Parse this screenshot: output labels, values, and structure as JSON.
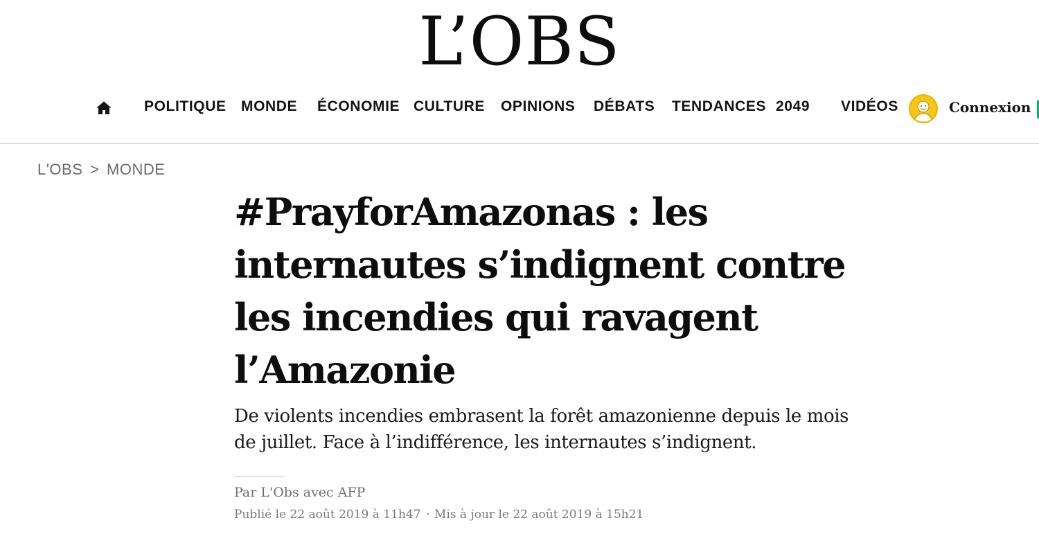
{
  "header": {
    "logo": "L’OBS"
  },
  "nav": {
    "home_icon": "home-icon",
    "items": [
      "POLITIQUE",
      "MONDE",
      "ÉCONOMIE",
      "CULTURE",
      "OPINIONS",
      "DÉBATS",
      "TENDANCES",
      "2049",
      "VIDÉOS"
    ],
    "avatar_icon": "user-avatar-icon",
    "login_label": "Connexion"
  },
  "breadcrumb": {
    "root": "L'OBS",
    "separator": ">",
    "section": "MONDE"
  },
  "article": {
    "headline": "#PrayforAmazonas : les internautes s’indignent contre les incendies qui ravagent l’Amazonie",
    "lede": "De violents incendies embrasent la forêt amazonienne depuis le mois de juillet. Face à l’indifférence, les internautes s’indignent.",
    "byline": "Par L'Obs avec AFP",
    "published": "Publié le 22 août 2019 à 11h47",
    "separator": "·",
    "updated": "Mis à jour le 22 août 2019 à 15h21"
  },
  "colors": {
    "text": "#111111",
    "muted": "#6b6b6b",
    "avatar": "#f5c518",
    "divider": "#c9c9c9"
  }
}
